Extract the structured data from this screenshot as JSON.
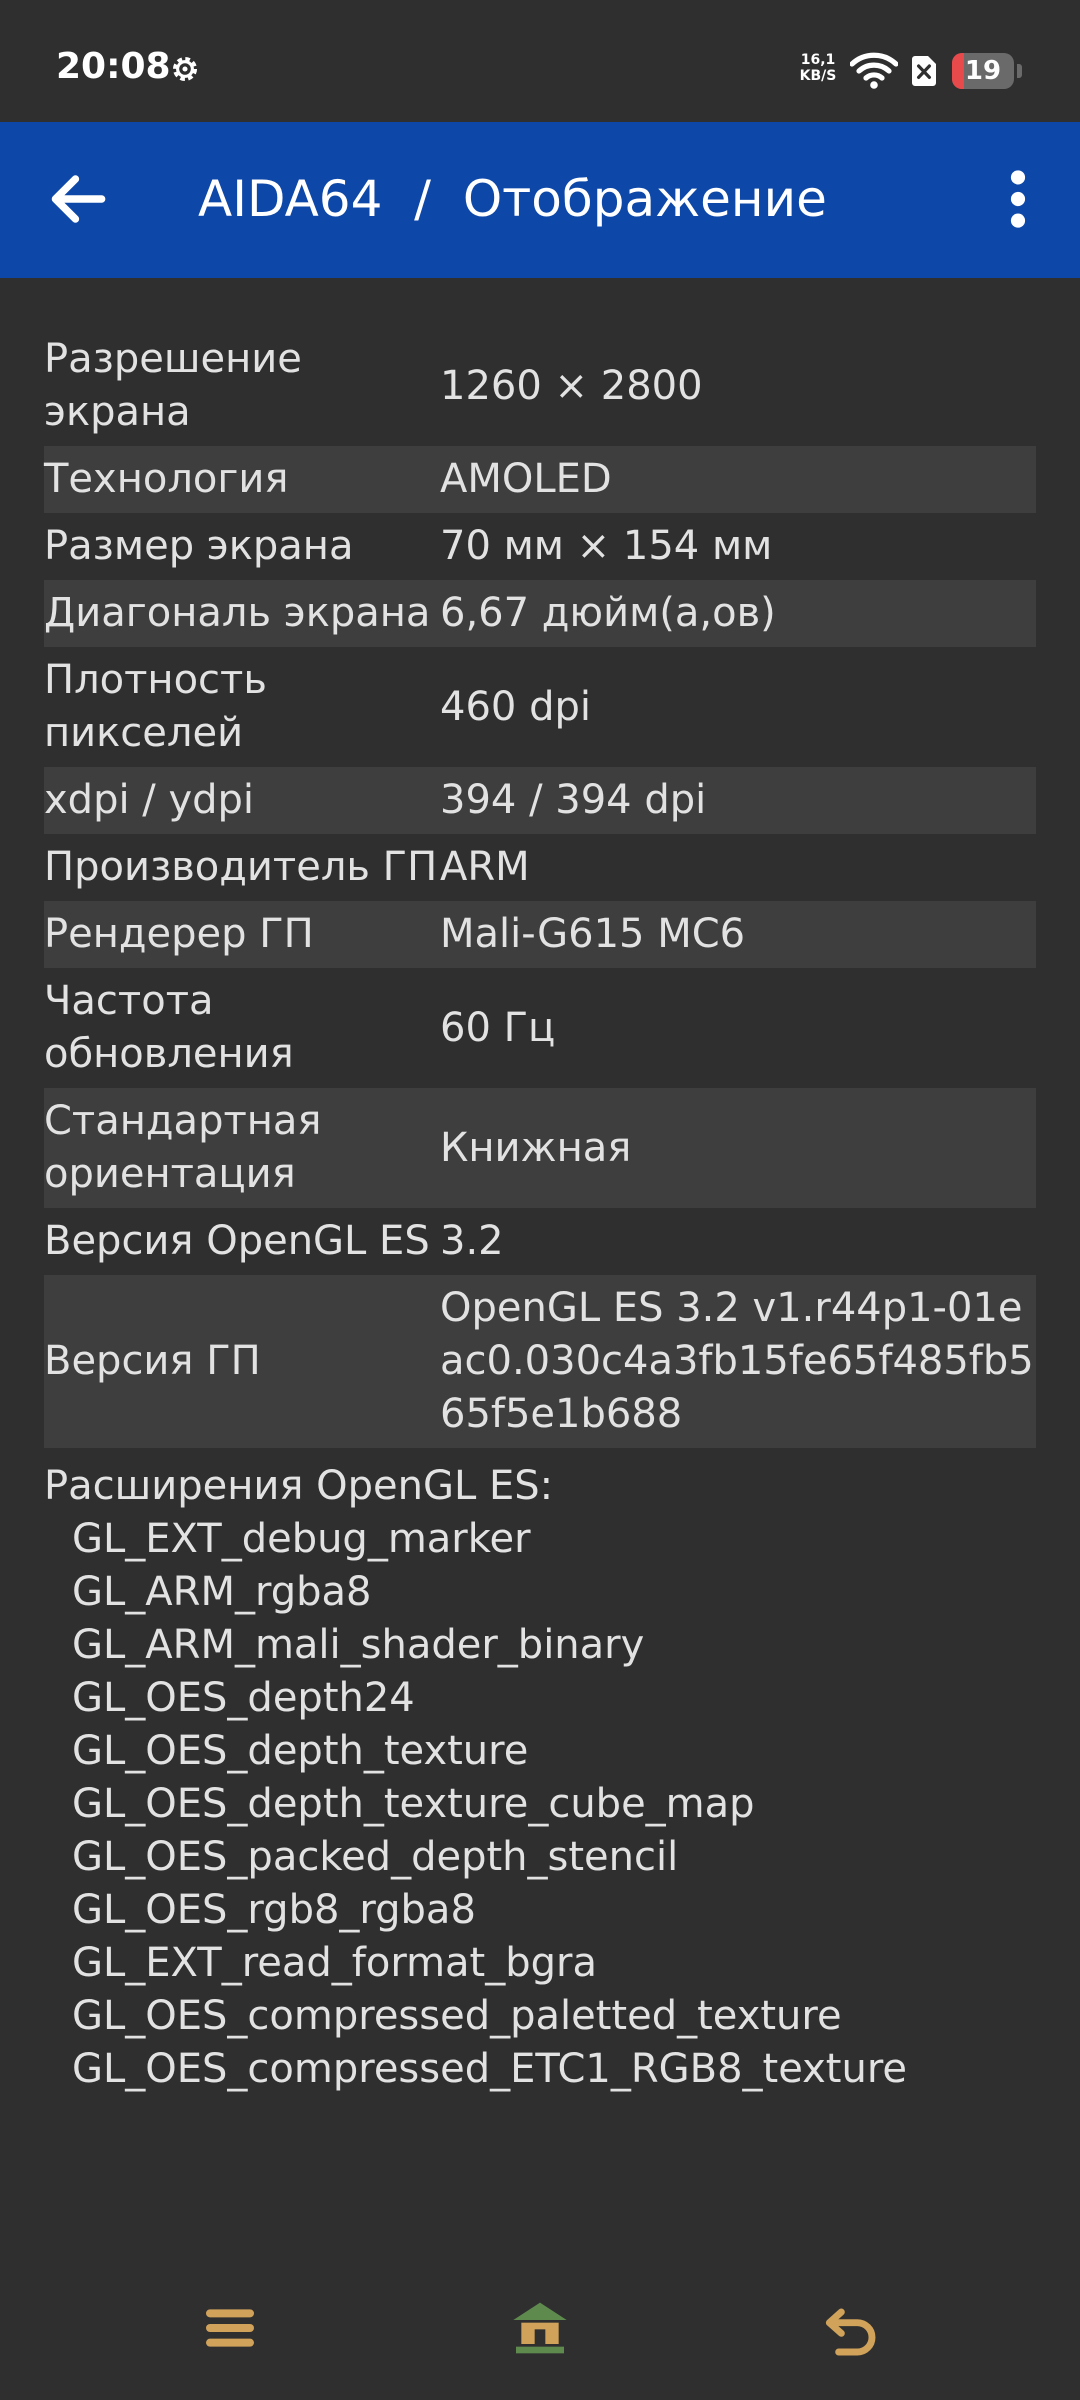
{
  "status_bar": {
    "time": "20:08",
    "settings_icon": "gear-icon",
    "net_speed_value": "16,1",
    "net_speed_unit": "KB/S",
    "wifi_icon": "wifi-icon",
    "sim_icon": "no-sim-icon",
    "battery_level": "19",
    "battery_fraction": 0.19,
    "battery_color": "#e8494b"
  },
  "app_bar": {
    "back_icon": "arrow-back-icon",
    "title": "AIDA64  /  Отображение",
    "menu_icon": "more-vert-icon",
    "color": "#0d47a8"
  },
  "rows": [
    {
      "label": "Разрешение экрана",
      "value": "1260 × 2800"
    },
    {
      "label": "Технология",
      "value": "AMOLED"
    },
    {
      "label": "Размер экрана",
      "value": "70 мм × 154 мм"
    },
    {
      "label": "Диагональ экрана",
      "value": "6,67 дюйм(а,ов)"
    },
    {
      "label": "Плотность пикселей",
      "value": "460 dpi"
    },
    {
      "label": "xdpi / ydpi",
      "value": "394 / 394 dpi"
    },
    {
      "label": "Производитель ГП",
      "value": "ARM"
    },
    {
      "label": "Рендерер ГП",
      "value": "Mali-G615 MC6"
    },
    {
      "label": "Частота обновления",
      "value": "60 Гц"
    },
    {
      "label": "Стандартная ориентация",
      "value": "Книжная"
    },
    {
      "label": "Версия OpenGL ES",
      "value": "3.2"
    },
    {
      "label": "Версия ГП",
      "value": "OpenGL ES 3.2 v1.r44p1-01eac0.030c4a3fb15fe65f485fb565f5e1b688"
    }
  ],
  "extensions": {
    "heading": "Расширения OpenGL ES:",
    "items": [
      "GL_EXT_debug_marker",
      "GL_ARM_rgba8",
      "GL_ARM_mali_shader_binary",
      "GL_OES_depth24",
      "GL_OES_depth_texture",
      "GL_OES_depth_texture_cube_map",
      "GL_OES_packed_depth_stencil",
      "GL_OES_rgb8_rgba8",
      "GL_EXT_read_format_bgra",
      "GL_OES_compressed_paletted_texture",
      "GL_OES_compressed_ETC1_RGB8_texture"
    ]
  },
  "nav_bar": {
    "menu_icon": "hamburger-menu-icon",
    "home_icon": "home-icon",
    "back_icon": "undo-back-icon",
    "icon_color": "#d0a25a"
  }
}
